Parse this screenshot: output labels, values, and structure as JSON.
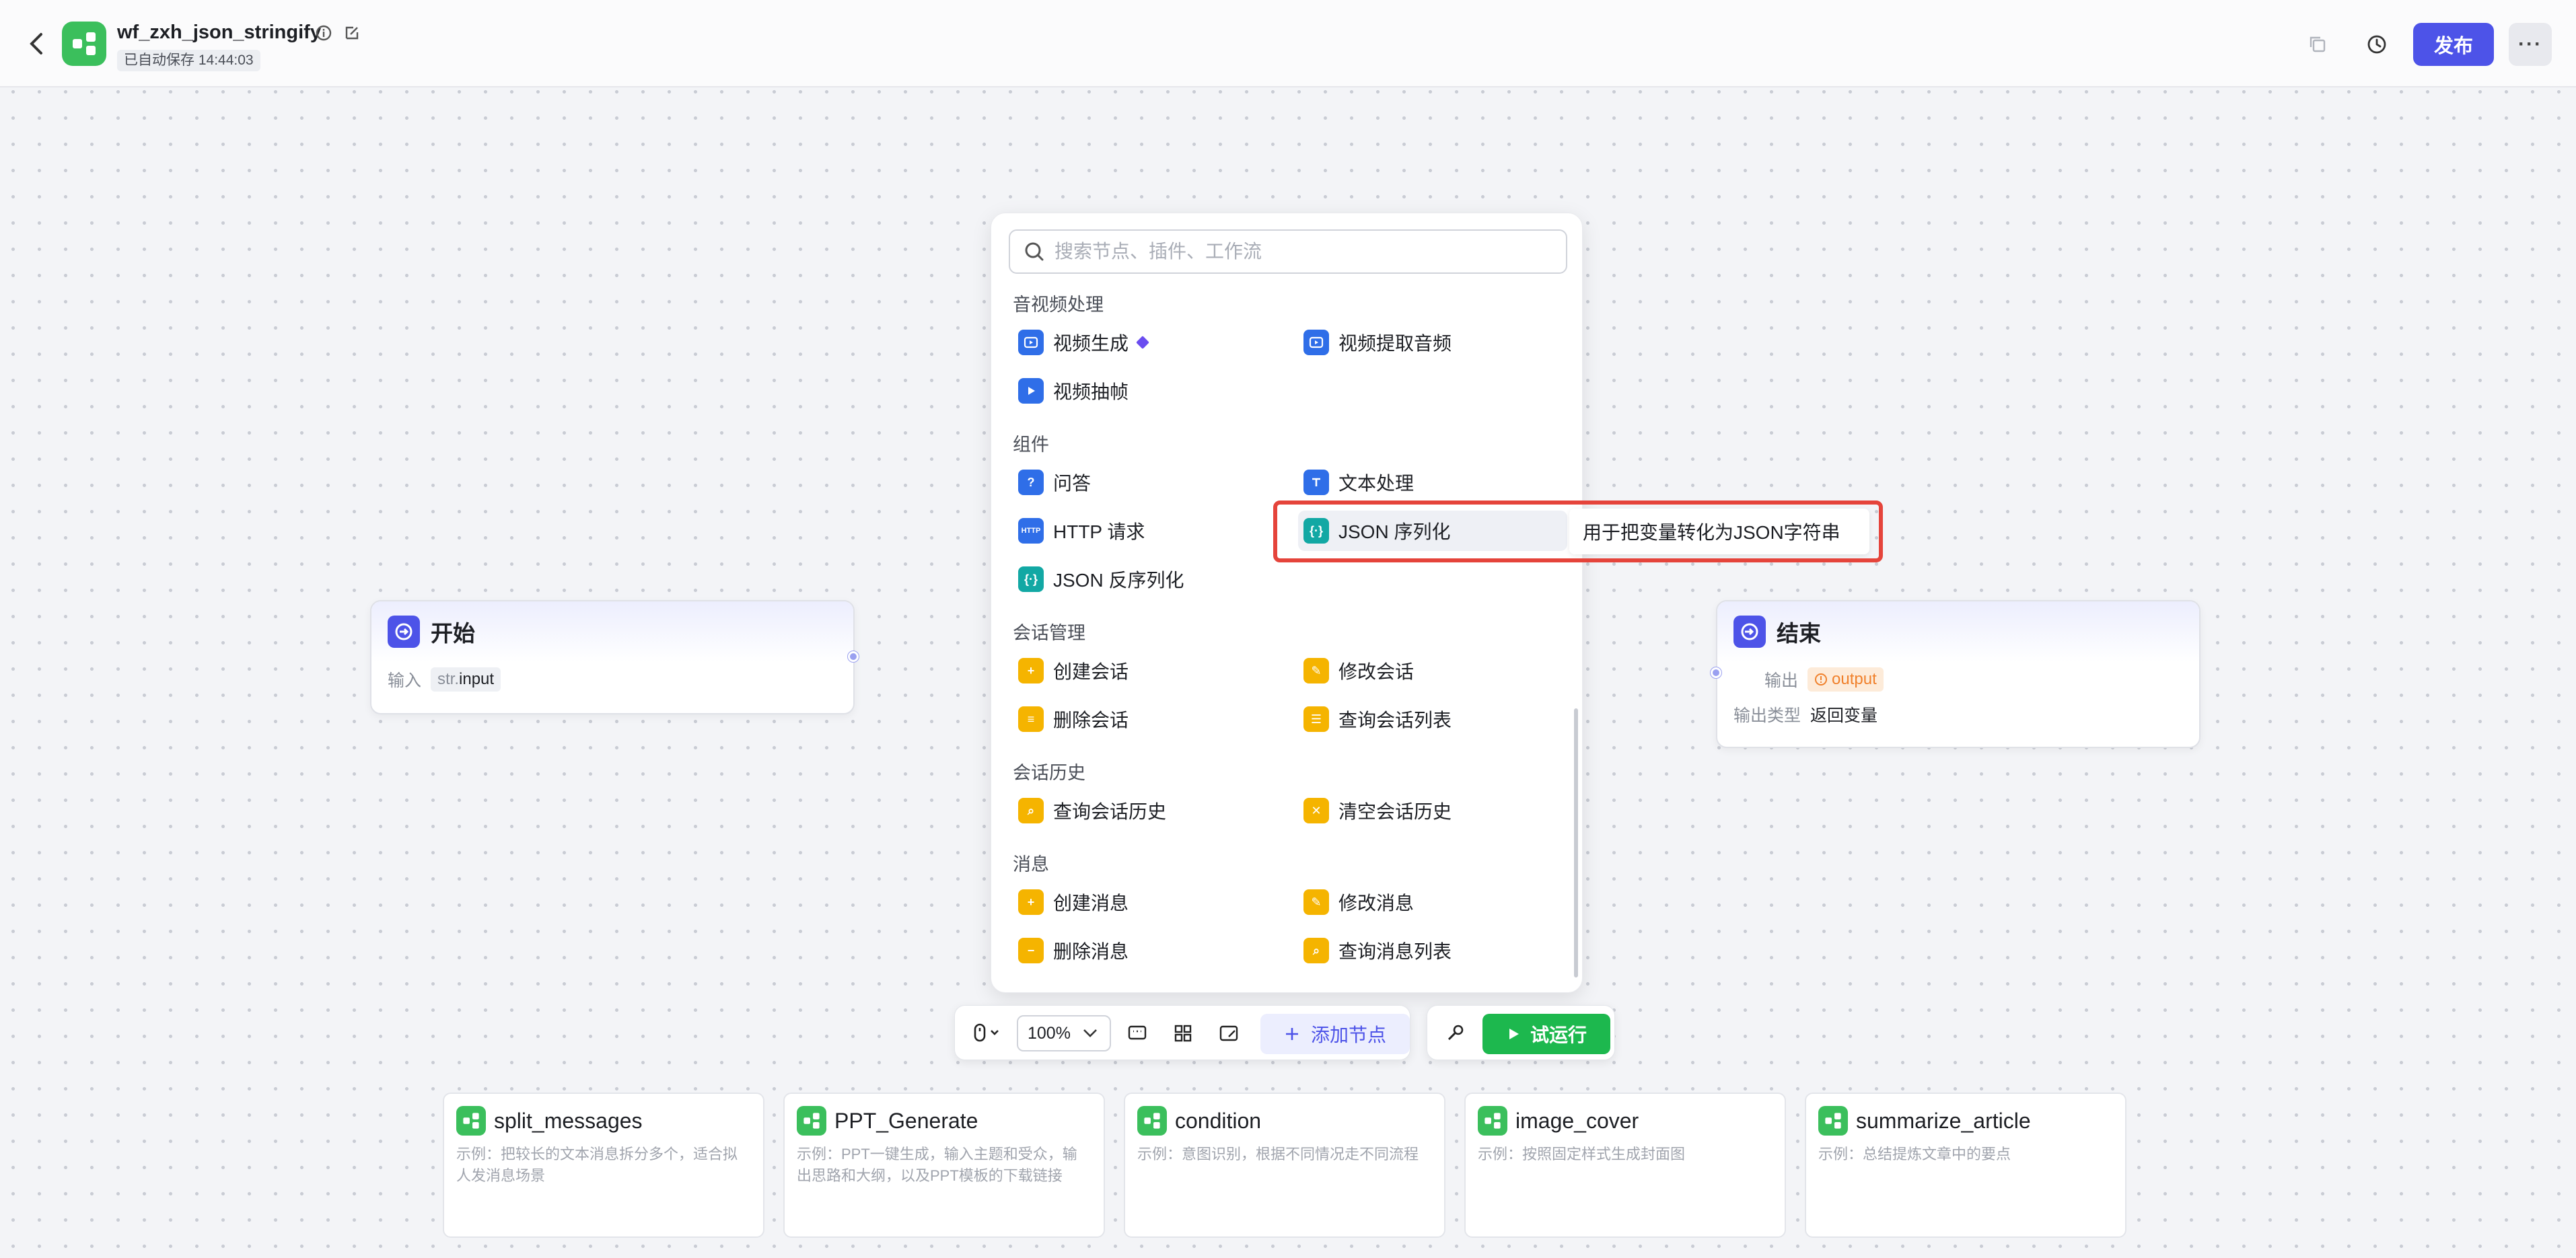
{
  "header": {
    "title": "wf_zxh_json_stringify",
    "autosave": "已自动保存 14:44:03",
    "publish_label": "发布",
    "more_label": "···"
  },
  "nodes": {
    "start": {
      "title": "开始",
      "input_label": "输入",
      "input_prefix": "str.",
      "input_name": "input"
    },
    "end": {
      "title": "结束",
      "output_label": "输出",
      "output_name": "output",
      "output_type_label": "输出类型",
      "output_type_value": "返回变量"
    }
  },
  "panel": {
    "search_placeholder": "搜索节点、插件、工作流",
    "sections": [
      {
        "title": "音视频处理",
        "items": [
          "视频生成",
          "视频提取音频",
          "视频抽帧"
        ]
      },
      {
        "title": "组件",
        "items": [
          "问答",
          "文本处理",
          "HTTP 请求",
          "JSON 序列化",
          "JSON 反序列化"
        ]
      },
      {
        "title": "会话管理",
        "items": [
          "创建会话",
          "修改会话",
          "删除会话",
          "查询会话列表"
        ]
      },
      {
        "title": "会话历史",
        "items": [
          "查询会话历史",
          "清空会话历史"
        ]
      },
      {
        "title": "消息",
        "items": [
          "创建消息",
          "修改消息",
          "删除消息",
          "查询消息列表"
        ]
      }
    ],
    "tooltip": "用于把变量转化为JSON字符串"
  },
  "toolbar": {
    "zoom": "100%",
    "add_node_label": "添加节点",
    "run_label": "试运行"
  },
  "templates": [
    {
      "title": "split_messages",
      "desc": "示例：把较长的文本消息拆分多个，适合拟人发消息场景"
    },
    {
      "title": "PPT_Generate",
      "desc": "示例：PPT一键生成，输入主题和受众，输出思路和大纲，以及PPT模板的下载链接"
    },
    {
      "title": "condition",
      "desc": "示例：意图识别，根据不同情况走不同流程"
    },
    {
      "title": "image_cover",
      "desc": "示例：按照固定样式生成封面图"
    },
    {
      "title": "summarize_article",
      "desc": "示例：总结提炼文章中的要点"
    }
  ],
  "colors": {
    "accent": "#4d53e8",
    "run": "#1db84e",
    "highlight_border": "#e5443b"
  }
}
